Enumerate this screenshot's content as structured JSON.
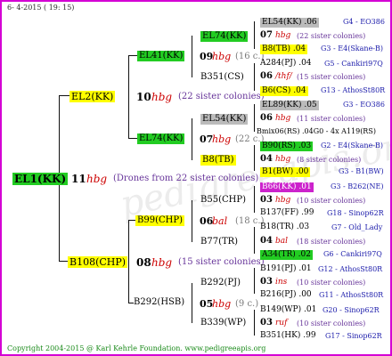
{
  "header": {
    "date": "6- 4-2015 ( 19: 15)"
  },
  "footer": {
    "copyright": "Copyright 2004-2015 @ Karl Kehrle Foundation.   www.pedigreeapis.org"
  },
  "root": {
    "id": "EL1(KK)",
    "num": "11",
    "hbg": "hbg",
    "note": "(Drones from 22 sister colonies)"
  },
  "sire": {
    "id": "EL2(KK)",
    "num": "10",
    "hbg": "hbg",
    "note": "(22 sister colonies)"
  },
  "dam": {
    "id": "B108(CHP)",
    "num": "08",
    "hbg": "hbg",
    "note": "(15 sister colonies)"
  },
  "gen3": [
    {
      "id": "EL41(KK)",
      "num": "09",
      "hbg": "hbg",
      "note": "(16 c.)",
      "second": "B351(CS)"
    },
    {
      "id": "EL74(KK)",
      "num": "07",
      "hbg": "hbg",
      "note": "(22 c.)",
      "second": "B8(TB)"
    },
    {
      "id": "B99(CHP)",
      "num": "06",
      "hbg": "bal",
      "note": "(18 c.)",
      "second": "B77(TR)"
    },
    {
      "id": "B292(HSB)",
      "num": "05",
      "hbg": "hbg",
      "note": "(9 c.)",
      "second": "B339(WP)"
    }
  ],
  "gen4_top": [
    "EL74(KK)",
    "EL54(KK)",
    "B55(CHP)",
    "B292(PJ)"
  ],
  "gen5": [
    {
      "a": "EL54(KK) .06",
      "ar": "G4 - EO386",
      "num": "07",
      "hbg": "hbg",
      "note": "(22 sister colonies)",
      "b": "B8(TB) .04",
      "br": "G3 - E4(Skane-B)"
    },
    {
      "a": "A284(PJ) .04",
      "ar": "G5 - Cankiri97Q",
      "num": "06",
      "hbg": "/thf/",
      "note": "(15 sister colonies)",
      "b": "B6(CS) .04",
      "br": "G13 - AthosSt80R"
    },
    {
      "a": "EL89(KK) .05",
      "ar": "G3 - EO386",
      "num": "06",
      "hbg": "hbg",
      "note": "(11 sister colonies)",
      "b": "Bmix06(RS) .04G0 - 4x A119(RS)",
      "br": ""
    },
    {
      "a": "B90(RS) .03",
      "ar": "G2 - E4(Skane-B)",
      "num": "04",
      "hbg": "hbg",
      "note": "(8 sister colonies)",
      "b": "B1(BW) .00",
      "br": "G3 - B1(BW)"
    },
    {
      "a": "B66(KK) .01",
      "ar": "G3 - B262(NE)",
      "num": "03",
      "hbg": "hbg",
      "note": "(10 sister colonies)",
      "b": "B137(FF) .99",
      "br": "G18 - Sinop62R"
    },
    {
      "a": "B18(TR) .03",
      "ar": "G7 - Old_Lady",
      "num": "04",
      "hbg": "bal",
      "note": "(18 sister colonies)",
      "b": "A34(TR) .02",
      "br": "G6 - Cankiri97Q"
    },
    {
      "a": "B191(PJ) .01",
      "ar": "G12 - AthosSt80R",
      "num": "03",
      "hbg": "ins",
      "note": "(10 sister colonies)",
      "b": "B216(PJ) .00",
      "br": "G11 - AthosSt80R"
    },
    {
      "a": "B149(WP) .01",
      "ar": "G20 - Sinop62R",
      "num": "03",
      "hbg": "ruf",
      "note": "(10 sister colonies)",
      "b": "B351(HK) .99",
      "br": "G17 - Sinop62R"
    }
  ]
}
